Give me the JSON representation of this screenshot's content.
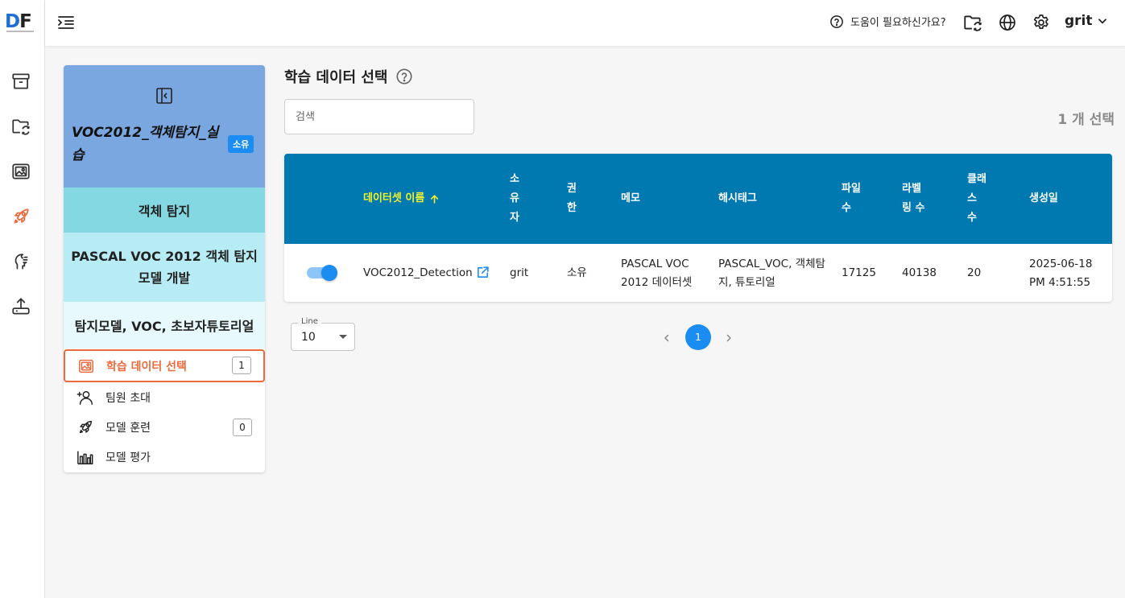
{
  "brand": {
    "logo_d": "D",
    "logo_f": "F"
  },
  "topbar": {
    "help_text": "도움이 필요하신가요?",
    "user_name": "grit",
    "icons": [
      "menu-toggle-icon",
      "help-circle-icon",
      "folder-sync-icon",
      "globe-icon",
      "gear-icon",
      "chevron-down-icon"
    ]
  },
  "rail": {
    "icons": [
      "archive-box-icon",
      "folder-sync-icon",
      "image-icon",
      "rocket-icon",
      "brain-head-icon",
      "upload-icon"
    ],
    "active": "rocket-icon"
  },
  "project": {
    "title": "VOC2012_객체탐지_실습",
    "badge": "소유",
    "task": "객체 탐지",
    "description": "PASCAL VOC 2012 객체 탐지 모델 개발",
    "tags": "탐지모델, VOC, 초보자튜토리얼",
    "menu": [
      {
        "label": "학습 데이터 선택",
        "count": "1",
        "active": true
      },
      {
        "label": "팀원 초대"
      },
      {
        "label": "모델 훈련",
        "count": "0"
      },
      {
        "label": "모델 평가"
      }
    ]
  },
  "main": {
    "title": "학습 데이터 선택",
    "search_placeholder": "검색",
    "selected_count": "1 개 선택",
    "table": {
      "headers": {
        "name": "데이터셋 이름",
        "owner": "소\n유\n자",
        "permission": "권\n한",
        "memo": "메모",
        "hashtags": "해시태그",
        "files": "파일\n수",
        "labels": "라벨\n링 수",
        "classes": "클래\n스\n수",
        "created": "생성일"
      },
      "sort": {
        "column": "name",
        "direction": "ascending"
      },
      "rows": [
        {
          "selected": true,
          "name": "VOC2012_Detection",
          "owner": "grit",
          "permission": "소유",
          "memo": "PASCAL VOC\n2012 데이터셋",
          "hashtags": "PASCAL_VOC, 객체탐\n지, 튜토리얼",
          "files": "17125",
          "labels": "40138",
          "classes": "20",
          "created": "2025-06-18\nPM 4:51:55"
        }
      ]
    },
    "pagination": {
      "line_label": "Line",
      "line_value": "10",
      "current_page": "1"
    }
  },
  "colors": {
    "accent_blue": "#1b8cf2",
    "table_header": "#0079b0",
    "sort_header": "#f4f22a",
    "active_menu": "#ec6a3c",
    "project_header": "#7aa7df",
    "task_bg": "#84d8e2",
    "desc_bg": "#b8ecf4",
    "tags_bg": "#e7f9fc"
  }
}
